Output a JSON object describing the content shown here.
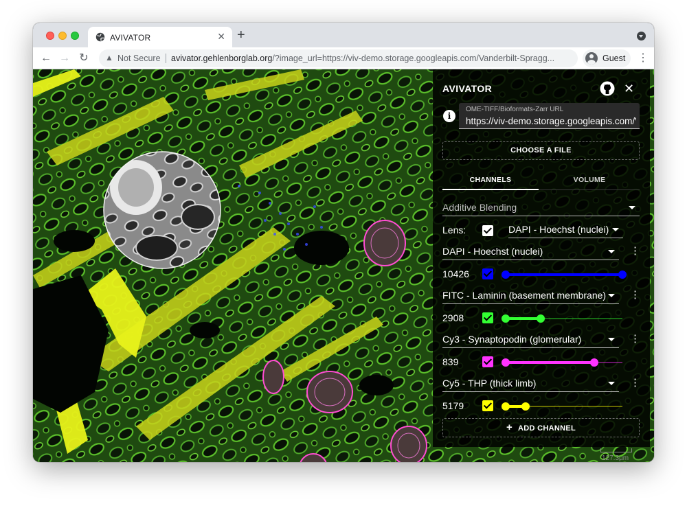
{
  "browser": {
    "tab_title": "AVIVATOR",
    "new_tab": "+",
    "security_label": "Not Secure",
    "url_host": "avivator.gehlenborglab.org",
    "url_rest": "/?image_url=https://viv-demo.storage.googleapis.com/Vanderbilt-Spragg...",
    "profile_label": "Guest"
  },
  "panel": {
    "title": "AVIVATOR",
    "url_label": "OME-TIFF/Bioformats-Zarr URL",
    "url_value": "https://viv-demo.storage.googleapis.com/Vanderbilt-Spraggins-Kidney-MxIF.ome.tif",
    "choose_file": "CHOOSE A FILE",
    "tabs": [
      {
        "label": "CHANNELS",
        "active": true
      },
      {
        "label": "VOLUME",
        "active": false
      }
    ],
    "blending": "Additive Blending",
    "lens_label": "Lens:",
    "lens_checked": true,
    "lens_channel": "DAPI - Hoechst (nuclei)",
    "channels": [
      {
        "name": "DAPI - Hoechst (nuclei)",
        "value": "10426",
        "color": "#0000ff",
        "range": [
          0.0,
          1.0
        ]
      },
      {
        "name": "FITC - Laminin (basement membrane)",
        "value": "2908",
        "color": "#33ff33",
        "range": [
          0.0,
          0.3
        ]
      },
      {
        "name": "Cy3 - Synaptopodin (glomerular)",
        "value": "839",
        "color": "#ff33ff",
        "range": [
          0.0,
          0.76
        ]
      },
      {
        "name": "Cy5 - THP (thick limb)",
        "value": "5179",
        "color": "#ffff00",
        "range": [
          0.0,
          0.17
        ]
      }
    ],
    "add_channel": "ADD CHANNEL"
  },
  "scale_bar": "127.3µm",
  "colors": {
    "panel_bg": "#000000",
    "dapi": "#0000ff",
    "fitc": "#33ff33",
    "cy3": "#ff33ff",
    "cy5": "#ffff00"
  }
}
